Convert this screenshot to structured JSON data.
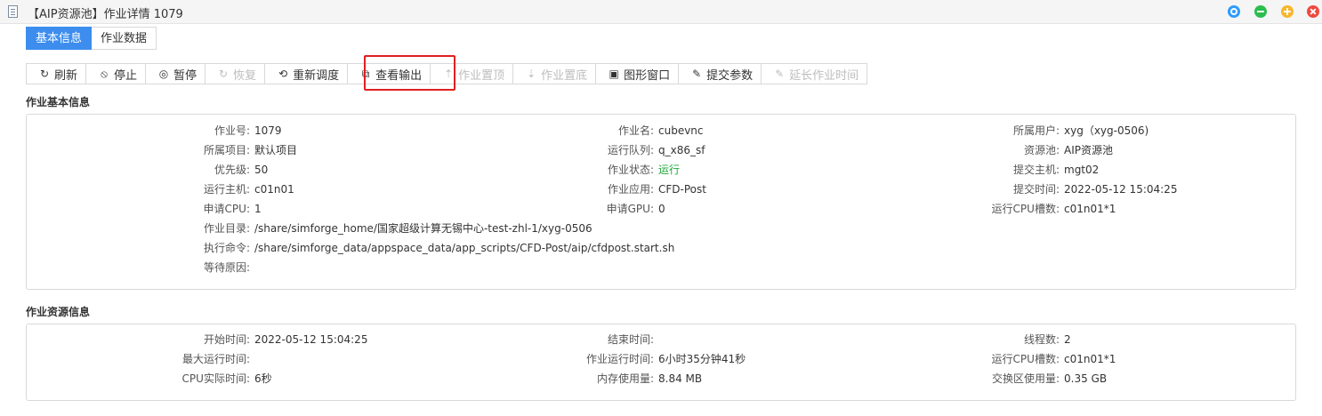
{
  "window": {
    "title": "【AIP资源池】作业详情 1079"
  },
  "tabs": [
    {
      "label": "基本信息",
      "active": true
    },
    {
      "label": "作业数据",
      "active": false
    }
  ],
  "toolbar": [
    {
      "label": "刷新",
      "icon": "refresh-icon",
      "glyph": "↻",
      "enabled": true
    },
    {
      "label": "停止",
      "icon": "stop-icon",
      "glyph": "⦸",
      "enabled": true
    },
    {
      "label": "暂停",
      "icon": "pause-icon",
      "glyph": "◎",
      "enabled": true
    },
    {
      "label": "恢复",
      "icon": "resume-icon",
      "glyph": "↻",
      "enabled": false
    },
    {
      "label": "重新调度",
      "icon": "reschedule-icon",
      "glyph": "⟲",
      "enabled": true
    },
    {
      "label": "查看输出",
      "icon": "view-output-icon",
      "glyph": "⧉",
      "enabled": true
    },
    {
      "label": "作业置顶",
      "icon": "top-icon",
      "glyph": "⇡",
      "enabled": false
    },
    {
      "label": "作业置底",
      "icon": "bottom-icon",
      "glyph": "⇣",
      "enabled": false
    },
    {
      "label": "图形窗口",
      "icon": "graphic-window-icon",
      "glyph": "▣",
      "enabled": true
    },
    {
      "label": "提交参数",
      "icon": "submit-params-icon",
      "glyph": "✎",
      "enabled": true
    },
    {
      "label": "延长作业时间",
      "icon": "extend-time-icon",
      "glyph": "✎",
      "enabled": false
    }
  ],
  "basic_info": {
    "title": "作业基本信息",
    "rows": [
      [
        {
          "label": "作业号:",
          "value": "1079"
        },
        {
          "label": "作业名:",
          "value": "cubevnc"
        },
        {
          "label": "所属用户:",
          "value": "xyg（xyg-0506)"
        }
      ],
      [
        {
          "label": "所属项目:",
          "value": "默认项目"
        },
        {
          "label": "运行队列:",
          "value": "q_x86_sf"
        },
        {
          "label": "资源池:",
          "value": "AIP资源池"
        }
      ],
      [
        {
          "label": "优先级:",
          "value": "50"
        },
        {
          "label": "作业状态:",
          "value": "运行",
          "status": true
        },
        {
          "label": "提交主机:",
          "value": "mgt02"
        }
      ],
      [
        {
          "label": "运行主机:",
          "value": "c01n01"
        },
        {
          "label": "作业应用:",
          "value": "CFD-Post"
        },
        {
          "label": "提交时间:",
          "value": "2022-05-12 15:04:25"
        }
      ],
      [
        {
          "label": "申请CPU:",
          "value": "1"
        },
        {
          "label": "申请GPU:",
          "value": "0"
        },
        {
          "label": "运行CPU槽数:",
          "value": "c01n01*1"
        }
      ]
    ],
    "wide_rows": [
      {
        "label": "作业目录:",
        "value": "/share/simforge_home/国家超级计算无锡中心-test-zhl-1/xyg-0506"
      },
      {
        "label": "执行命令:",
        "value": "/share/simforge_data/appspace_data/app_scripts/CFD-Post/aip/cfdpost.start.sh"
      },
      {
        "label": "等待原因:",
        "value": ""
      }
    ]
  },
  "resource_info": {
    "title": "作业资源信息",
    "rows": [
      [
        {
          "label": "开始时间:",
          "value": "2022-05-12 15:04:25"
        },
        {
          "label": "结束时间:",
          "value": ""
        },
        {
          "label": "线程数:",
          "value": "2"
        }
      ],
      [
        {
          "label": "最大运行时间:",
          "value": ""
        },
        {
          "label": "作业运行时间:",
          "value": "6小时35分钟41秒"
        },
        {
          "label": "运行CPU槽数:",
          "value": "c01n01*1"
        }
      ],
      [
        {
          "label": "CPU实际时间:",
          "value": "6秒"
        },
        {
          "label": "内存使用量:",
          "value": "8.84 MB"
        },
        {
          "label": "交换区使用量:",
          "value": "0.35 GB"
        }
      ]
    ]
  },
  "colors": {
    "accent": "#3c8dee",
    "status_running": "#1eaa3a",
    "highlight": "#e02020"
  }
}
